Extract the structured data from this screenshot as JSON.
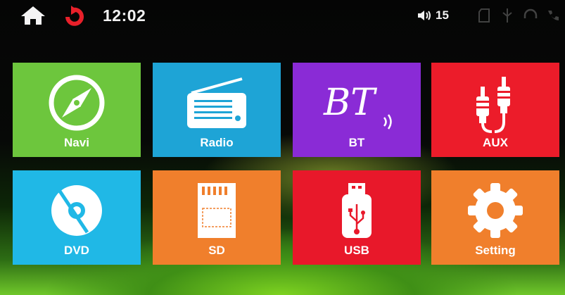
{
  "status_bar": {
    "home_icon": "home-icon",
    "back_icon": "back-icon",
    "clock": "12:02",
    "volume_icon": "speaker-icon",
    "volume": "15",
    "indicators": [
      "sd-card-icon",
      "usb-icon",
      "headset-icon",
      "phone-icon"
    ]
  },
  "tiles": [
    {
      "label": "Navi",
      "icon": "compass-icon",
      "color": "#6dc63d"
    },
    {
      "label": "Radio",
      "icon": "radio-icon",
      "color": "#1ea4d6"
    },
    {
      "label": "BT",
      "icon": "bluetooth-bt-icon",
      "color": "#8a2bd6"
    },
    {
      "label": "AUX",
      "icon": "rca-cable-icon",
      "color": "#ec1c2a"
    },
    {
      "label": "DVD",
      "icon": "disc-icon",
      "color": "#20b8e6"
    },
    {
      "label": "SD",
      "icon": "sd-card-icon",
      "color": "#f07f2c"
    },
    {
      "label": "USB",
      "icon": "usb-drive-icon",
      "color": "#e8182a"
    },
    {
      "label": "Setting",
      "icon": "gear-icon",
      "color": "#f07f2c"
    }
  ],
  "bt_icon_text": "BT"
}
